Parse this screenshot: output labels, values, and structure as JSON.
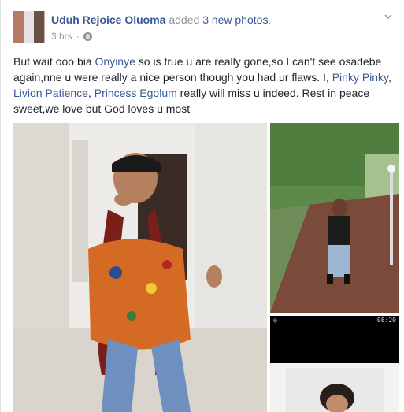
{
  "post": {
    "author": "Uduh Rejoice Oluoma",
    "action_prefix": "added",
    "action_link": "3 new photos",
    "action_suffix": ".",
    "time": "3 hrs",
    "meta_separator": "·",
    "privacy_icon": "globe-icon",
    "options_icon": "chevron-down-icon",
    "text_parts": {
      "p1": "But wait ooo bia ",
      "mention1": "Onyinye",
      "p2": " so is true u are really gone,so I can't see osadebe again,nne u were really a nice person though you had ur flaws. I, ",
      "mention2": "Pinky Pinky",
      "p3": ", ",
      "mention3": "Livion Patience",
      "p4": ", ",
      "mention4": "Princess Egolum",
      "p5": " really will miss u indeed. Rest in peace sweet,we love but God loves u most"
    }
  },
  "photos": {
    "count": 3,
    "status_bar_right": "08:20"
  },
  "colors": {
    "link": "#365899",
    "meta": "#90949c",
    "text": "#1d2129"
  }
}
